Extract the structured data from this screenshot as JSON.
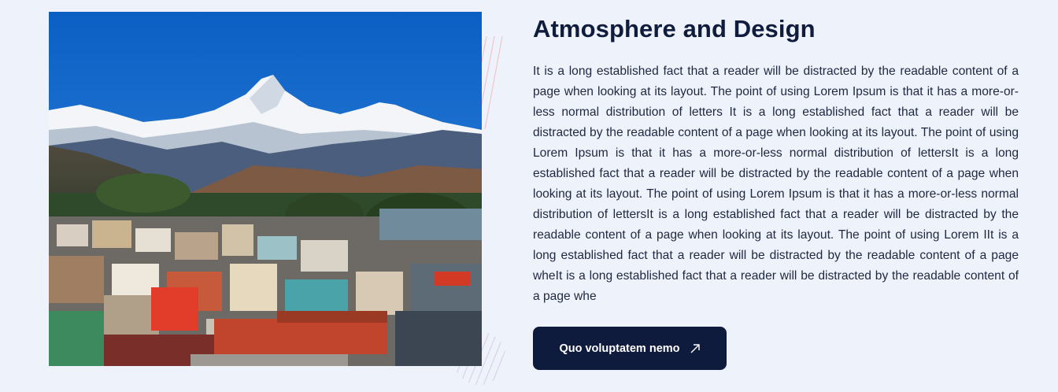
{
  "section": {
    "title": "Atmosphere and Design",
    "body": "It is a long established fact that a reader will be distracted by the readable content of a page when looking at its layout. The point of using Lorem Ipsum is that it has a more-or-less normal distribution of letters It is a long established fact that a reader will be distracted by the readable content of a page when looking at its layout. The point of using Lorem Ipsum is that it has a more-or-less normal distribution of lettersIt is a long established fact that a reader will be distracted by the readable content of a page when looking at its layout. The point of using Lorem Ipsum is that it has a more-or-less normal distribution of lettersIt is a long established fact that a reader will be distracted by the readable content of a page when looking at its layout. The point of using Lorem IIt is a long established fact that a reader will be distracted by the readable content of a page wheIt is a long established fact that a reader will be distracted by the readable content of a page whe",
    "cta_label": "Quo voluptatem nemo",
    "cta_icon": "arrow-up-right-icon"
  },
  "image": {
    "subject": "mountain-town-photo",
    "icon": "landscape-image"
  },
  "colors": {
    "background": "#eef3fb",
    "heading": "#0f1c3d",
    "button_bg": "#0f1b3c",
    "button_text": "#ffffff",
    "deco_stripe": "#f2b8c4"
  }
}
